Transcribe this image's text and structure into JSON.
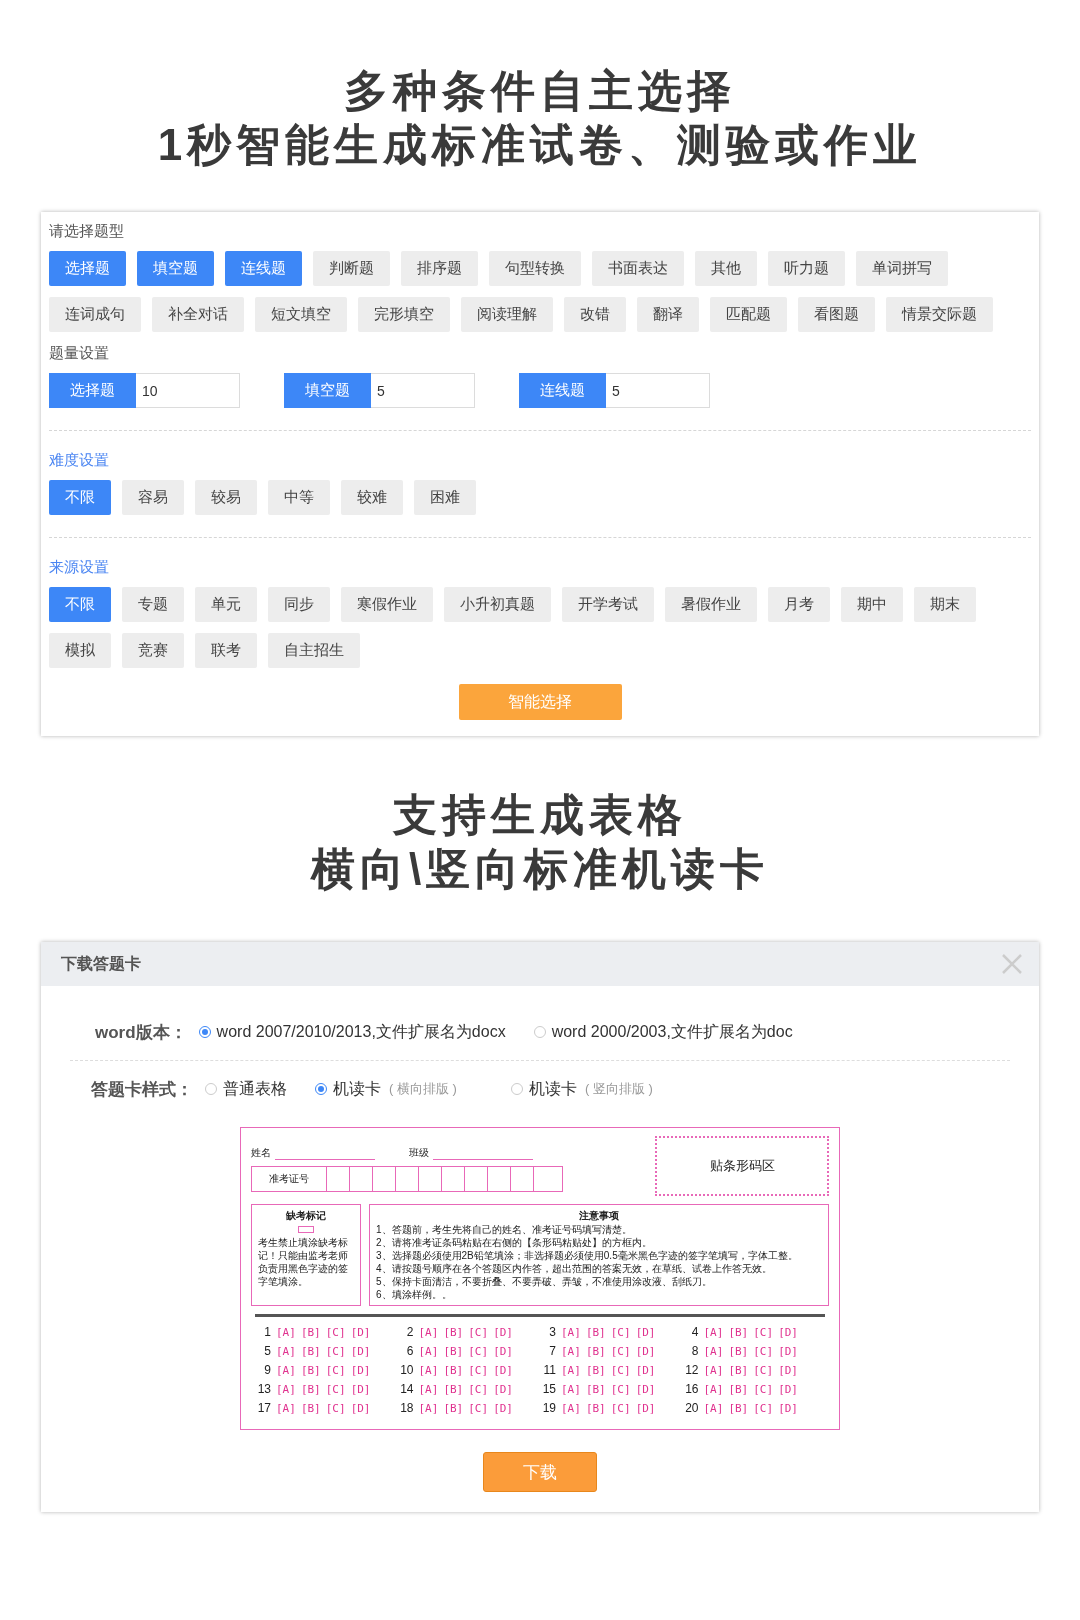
{
  "headline_top": [
    "多种条件自主选择",
    "1秒智能生成标准试卷、测验或作业"
  ],
  "filter_panel": {
    "type_section": {
      "label": "请选择题型",
      "options": [
        {
          "label": "选择题",
          "selected": true
        },
        {
          "label": "填空题",
          "selected": true
        },
        {
          "label": "连线题",
          "selected": true
        },
        {
          "label": "判断题",
          "selected": false
        },
        {
          "label": "排序题",
          "selected": false
        },
        {
          "label": "句型转换",
          "selected": false
        },
        {
          "label": "书面表达",
          "selected": false
        },
        {
          "label": "其他",
          "selected": false
        },
        {
          "label": "听力题",
          "selected": false
        },
        {
          "label": "单词拼写",
          "selected": false
        },
        {
          "label": "连词成句",
          "selected": false
        },
        {
          "label": "补全对话",
          "selected": false
        },
        {
          "label": "短文填空",
          "selected": false
        },
        {
          "label": "完形填空",
          "selected": false
        },
        {
          "label": "阅读理解",
          "selected": false
        },
        {
          "label": "改错",
          "selected": false
        },
        {
          "label": "翻译",
          "selected": false
        },
        {
          "label": "匹配题",
          "selected": false
        },
        {
          "label": "看图题",
          "selected": false
        },
        {
          "label": "情景交际题",
          "selected": false
        }
      ]
    },
    "quantity_section": {
      "label": "题量设置",
      "items": [
        {
          "label": "选择题",
          "value": "10"
        },
        {
          "label": "填空题",
          "value": "5"
        },
        {
          "label": "连线题",
          "value": "5"
        }
      ]
    },
    "difficulty_section": {
      "label": "难度设置",
      "options": [
        {
          "label": "不限",
          "selected": true
        },
        {
          "label": "容易",
          "selected": false
        },
        {
          "label": "较易",
          "selected": false
        },
        {
          "label": "中等",
          "selected": false
        },
        {
          "label": "较难",
          "selected": false
        },
        {
          "label": "困难",
          "selected": false
        }
      ]
    },
    "source_section": {
      "label": "来源设置",
      "options": [
        {
          "label": "不限",
          "selected": true
        },
        {
          "label": "专题",
          "selected": false
        },
        {
          "label": "单元",
          "selected": false
        },
        {
          "label": "同步",
          "selected": false
        },
        {
          "label": "寒假作业",
          "selected": false
        },
        {
          "label": "小升初真题",
          "selected": false
        },
        {
          "label": "开学考试",
          "selected": false
        },
        {
          "label": "暑假作业",
          "selected": false
        },
        {
          "label": "月考",
          "selected": false
        },
        {
          "label": "期中",
          "selected": false
        },
        {
          "label": "期末",
          "selected": false
        },
        {
          "label": "模拟",
          "selected": false
        },
        {
          "label": "竞赛",
          "selected": false
        },
        {
          "label": "联考",
          "selected": false
        },
        {
          "label": "自主招生",
          "selected": false
        }
      ]
    },
    "submit_button": "智能选择"
  },
  "headline_middle": [
    "支持生成表格",
    "横向\\竖向标准机读卡"
  ],
  "dialog": {
    "title": "下载答题卡",
    "word_version": {
      "label": "word版本：",
      "options": [
        {
          "label": "word 2007/2010/2013,文件扩展名为docx",
          "selected": true
        },
        {
          "label": "word 2000/2003,文件扩展名为doc",
          "selected": false
        }
      ]
    },
    "card_style": {
      "label": "答题卡样式：",
      "options": [
        {
          "label": "普通表格",
          "selected": false
        },
        {
          "label": "机读卡",
          "note": "( 横向排版 )",
          "selected": true
        },
        {
          "label": "机读卡",
          "note": "( 竖向排版 )",
          "selected": false
        }
      ]
    },
    "answer_card": {
      "name_label": "姓名",
      "class_label": "班级",
      "exam_id_label": "准考证号",
      "barcode_label": "贴条形码区",
      "absence": {
        "title": "缺考标记",
        "text": "考生禁止填涂缺考标记！只能由监考老师负责用黑色字迹的签字笔填涂。"
      },
      "notices": {
        "title": "注意事项",
        "items": [
          "1、答题前，考生先将自己的姓名、准考证号码填写清楚。",
          "2、请将准考证条码粘贴在右侧的【条形码粘贴处】的方框内。",
          "3、选择题必须使用2B铅笔填涂；非选择题必须使用0.5毫米黑色字迹的签字笔填写，字体工整。",
          "4、请按题号顺序在各个答题区内作答，超出范围的答案无效，在草纸、试卷上作答无效。",
          "5、保持卡面清洁，不要折叠、不要弄破、弄皱，不准使用涂改液、刮纸刀。",
          "6、填涂样例。。"
        ]
      },
      "questions": [
        {
          "number": "1",
          "choices": [
            "[A]",
            "[B]",
            "[C]",
            "[D]"
          ]
        },
        {
          "number": "2",
          "choices": [
            "[A]",
            "[B]",
            "[C]",
            "[D]"
          ]
        },
        {
          "number": "3",
          "choices": [
            "[A]",
            "[B]",
            "[C]",
            "[D]"
          ]
        },
        {
          "number": "4",
          "choices": [
            "[A]",
            "[B]",
            "[C]",
            "[D]"
          ]
        },
        {
          "number": "5",
          "choices": [
            "[A]",
            "[B]",
            "[C]",
            "[D]"
          ]
        },
        {
          "number": "6",
          "choices": [
            "[A]",
            "[B]",
            "[C]",
            "[D]"
          ]
        },
        {
          "number": "7",
          "choices": [
            "[A]",
            "[B]",
            "[C]",
            "[D]"
          ]
        },
        {
          "number": "8",
          "choices": [
            "[A]",
            "[B]",
            "[C]",
            "[D]"
          ]
        },
        {
          "number": "9",
          "choices": [
            "[A]",
            "[B]",
            "[C]",
            "[D]"
          ]
        },
        {
          "number": "10",
          "choices": [
            "[A]",
            "[B]",
            "[C]",
            "[D]"
          ]
        },
        {
          "number": "11",
          "choices": [
            "[A]",
            "[B]",
            "[C]",
            "[D]"
          ]
        },
        {
          "number": "12",
          "choices": [
            "[A]",
            "[B]",
            "[C]",
            "[D]"
          ]
        },
        {
          "number": "13",
          "choices": [
            "[A]",
            "[B]",
            "[C]",
            "[D]"
          ]
        },
        {
          "number": "14",
          "choices": [
            "[A]",
            "[B]",
            "[C]",
            "[D]"
          ]
        },
        {
          "number": "15",
          "choices": [
            "[A]",
            "[B]",
            "[C]",
            "[D]"
          ]
        },
        {
          "number": "16",
          "choices": [
            "[A]",
            "[B]",
            "[C]",
            "[D]"
          ]
        },
        {
          "number": "17",
          "choices": [
            "[A]",
            "[B]",
            "[C]",
            "[D]"
          ]
        },
        {
          "number": "18",
          "choices": [
            "[A]",
            "[B]",
            "[C]",
            "[D]"
          ]
        },
        {
          "number": "19",
          "choices": [
            "[A]",
            "[B]",
            "[C]",
            "[D]"
          ]
        },
        {
          "number": "20",
          "choices": [
            "[A]",
            "[B]",
            "[C]",
            "[D]"
          ]
        }
      ]
    },
    "download_button": "下载"
  }
}
